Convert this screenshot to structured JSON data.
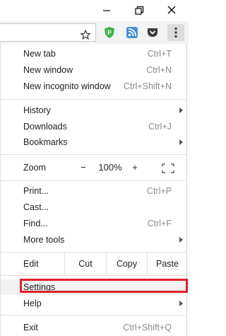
{
  "window_controls": {
    "minimize_icon": "minimize-icon",
    "maximize_icon": "restore-icon",
    "close_icon": "close-icon"
  },
  "toolbar": {
    "bookmark_icon": "star-icon",
    "extensions": [
      "shield-extension-icon",
      "rss-extension-icon",
      "pocket-extension-icon"
    ],
    "menu_icon": "vertical-dots-icon"
  },
  "menu": {
    "new_tab": {
      "label": "New tab",
      "shortcut": "Ctrl+T"
    },
    "new_window": {
      "label": "New window",
      "shortcut": "Ctrl+N"
    },
    "new_incognito": {
      "label": "New incognito window",
      "shortcut": "Ctrl+Shift+N"
    },
    "history": {
      "label": "History"
    },
    "downloads": {
      "label": "Downloads",
      "shortcut": "Ctrl+J"
    },
    "bookmarks": {
      "label": "Bookmarks"
    },
    "zoom": {
      "label": "Zoom",
      "minus": "−",
      "value": "100%",
      "plus": "+"
    },
    "print": {
      "label": "Print...",
      "shortcut": "Ctrl+P"
    },
    "cast": {
      "label": "Cast..."
    },
    "find": {
      "label": "Find...",
      "shortcut": "Ctrl+F"
    },
    "more_tools": {
      "label": "More tools"
    },
    "edit": {
      "label": "Edit",
      "cut": "Cut",
      "copy": "Copy",
      "paste": "Paste"
    },
    "settings": {
      "label": "Settings"
    },
    "help": {
      "label": "Help"
    },
    "exit": {
      "label": "Exit",
      "shortcut": "Ctrl+Shift+Q"
    }
  },
  "colors": {
    "highlight_border": "#e0202a",
    "toolbar_bg": "#f1f3f4",
    "shortcut_text": "#8a8a8a"
  }
}
